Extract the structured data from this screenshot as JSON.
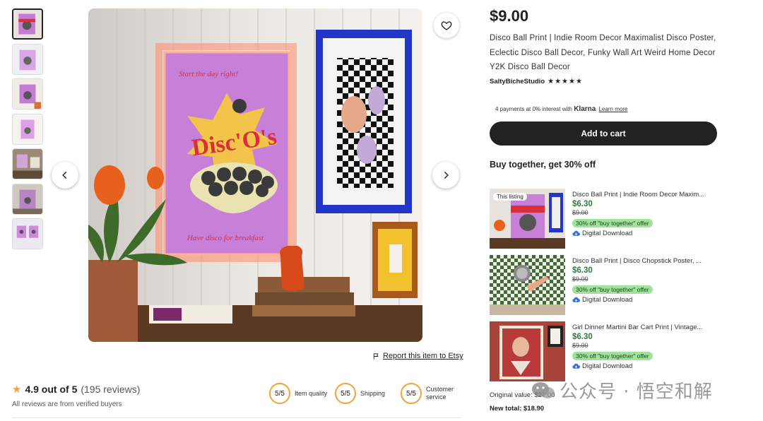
{
  "listing": {
    "price": "$9.00",
    "title": "Disco Ball Print | Indie Room Decor Maximalist Disco Poster, Eclectic Disco Ball Decor, Funky Wall Art Weird Home Decor Y2K Disco Ball Decor",
    "shop_name": "SaltyBicheStudio",
    "shop_stars": "★★★★★",
    "klarna_text": "4 payments at 0% interest with",
    "klarna_brand": "Klarna",
    "klarna_link": "Learn more",
    "add_to_cart": "Add to cart"
  },
  "main_image": {
    "poster_top": "Start the day right!",
    "poster_title": "Disc'O's",
    "poster_bottom": "Have disco for breakfast"
  },
  "report_link": "Report this item to Etsy",
  "reviews": {
    "score": "4.9 out of 5",
    "count": "(195 reviews)",
    "verified": "All reviews are from verified buyers",
    "metrics": [
      {
        "value": "5/5",
        "label": "Item quality"
      },
      {
        "value": "5/5",
        "label": "Shipping"
      },
      {
        "value": "5/5",
        "label": "Customer service"
      }
    ]
  },
  "bundle": {
    "heading": "Buy together, get 30% off",
    "this_listing_tag": "This listing",
    "items": [
      {
        "title": "Disco Ball Print | Indie Room Decor Maxim...",
        "price": "$6.30",
        "original": "$9.00",
        "offer": "30% off \"buy together\" offer",
        "type": "Digital Download"
      },
      {
        "title": "Disco Ball Print | Disco Chopstick Poster, ...",
        "price": "$6.30",
        "original": "$9.00",
        "offer": "30% off \"buy together\" offer",
        "type": "Digital Download"
      },
      {
        "title": "Girl Dinner Martini Bar Cart Print | Vintage...",
        "price": "$6.30",
        "original": "$9.00",
        "offer": "30% off \"buy together\" offer",
        "type": "Digital Download"
      }
    ],
    "original_value": "Original value: $27.00",
    "new_total": "New total: $18.90"
  },
  "watermark": "公众号 · 悟空和解",
  "colors": {
    "accent_green": "#2c7a3c",
    "offer_badge": "#9de39a",
    "cart_button": "#222222",
    "metric_ring": "#f1a23a"
  }
}
